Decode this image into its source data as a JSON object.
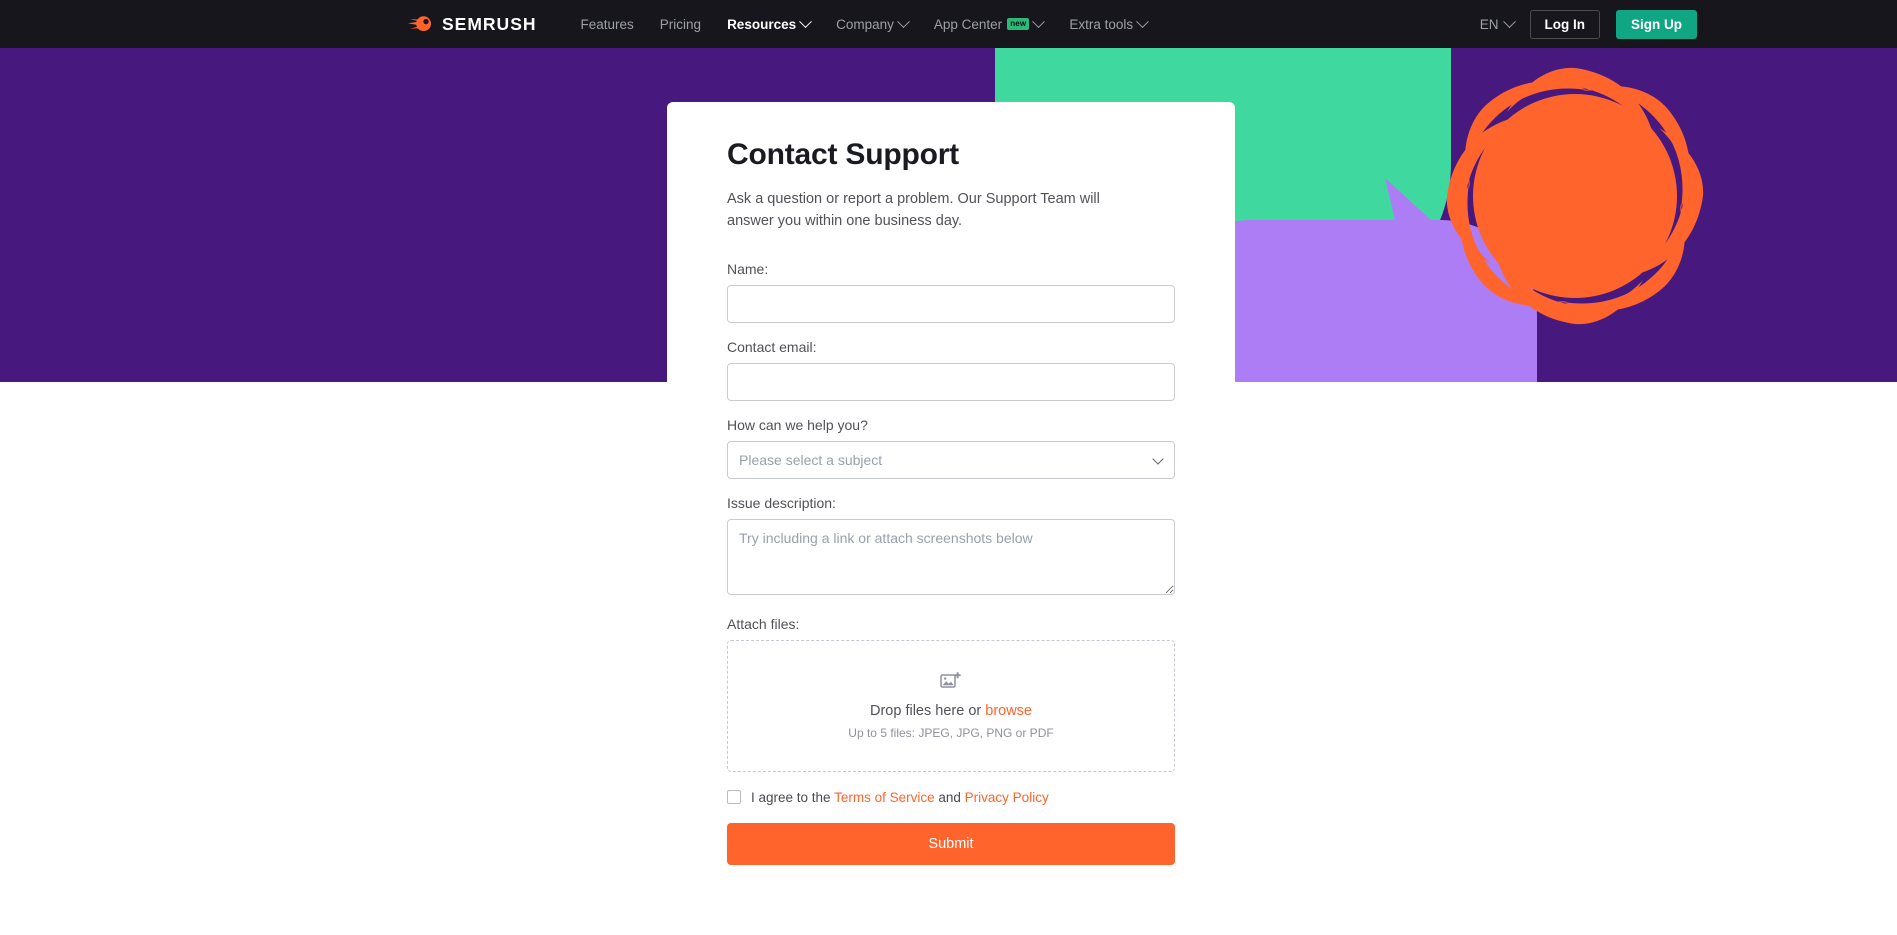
{
  "navbar": {
    "logo_text": "SEMRUSH",
    "logo_icon": "semrush-comet-icon",
    "links": [
      {
        "label": "Features",
        "has_chevron": false,
        "active": false,
        "badge": ""
      },
      {
        "label": "Pricing",
        "has_chevron": false,
        "active": false,
        "badge": ""
      },
      {
        "label": "Resources",
        "has_chevron": true,
        "active": true,
        "badge": ""
      },
      {
        "label": "Company",
        "has_chevron": true,
        "active": false,
        "badge": ""
      },
      {
        "label": "App Center",
        "has_chevron": true,
        "active": false,
        "badge": "new"
      },
      {
        "label": "Extra tools",
        "has_chevron": true,
        "active": false,
        "badge": ""
      }
    ],
    "language": "EN",
    "login_label": "Log In",
    "signup_label": "Sign Up"
  },
  "hero": {
    "background_color": "#47197f",
    "shapes": [
      {
        "name": "green-speech-bubble",
        "color": "#3fd9a0"
      },
      {
        "name": "purple-speech-bubble",
        "color": "#ad7df6"
      },
      {
        "name": "orange-pinwheel",
        "color": "#ff642d"
      }
    ]
  },
  "form": {
    "title": "Contact Support",
    "subtitle": "Ask a question or report a problem. Our Support Team will answer you within one business day.",
    "name": {
      "label": "Name:",
      "value": "",
      "placeholder": ""
    },
    "email": {
      "label": "Contact email:",
      "value": "",
      "placeholder": ""
    },
    "subject": {
      "label": "How can we help you?",
      "selected": "Please select a subject",
      "options": [
        "Please select a subject"
      ]
    },
    "description": {
      "label": "Issue description:",
      "value": "",
      "placeholder": "Try including a link or attach screenshots below"
    },
    "attach": {
      "label": "Attach files:",
      "icon": "image-add-icon",
      "drop_text": "Drop files here or",
      "browse_label": "browse",
      "hint": "Up to 5 files: JPEG, JPG, PNG or PDF"
    },
    "agreement": {
      "checked": false,
      "prefix": "I agree to the",
      "terms_label": "Terms of Service",
      "conjunction": "and",
      "privacy_label": "Privacy Policy"
    },
    "submit_label": "Submit"
  },
  "colors": {
    "brand_orange": "#ff642d",
    "brand_purple": "#47197f",
    "brand_green": "#11a683",
    "nav_dark": "#16161c"
  }
}
